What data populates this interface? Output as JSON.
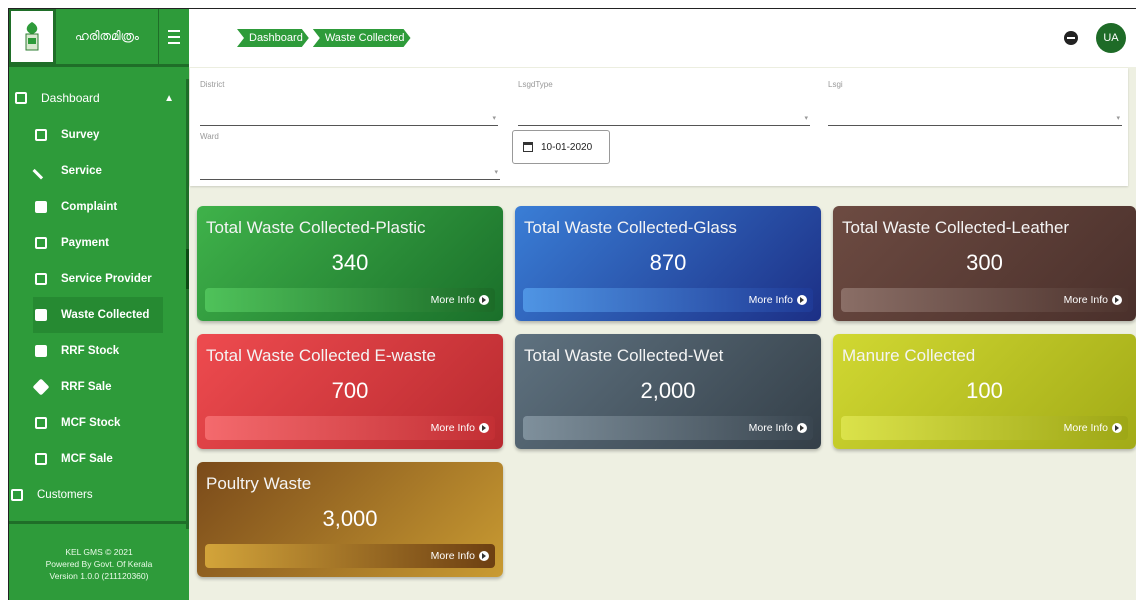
{
  "brand": {
    "name": "ഹരിതമിത്രം"
  },
  "breadcrumb": [
    {
      "label": "Dashboard"
    },
    {
      "label": "Waste Collected"
    }
  ],
  "user": {
    "initials": "UA"
  },
  "sidebar": {
    "head": {
      "label": "Dashboard"
    },
    "items": [
      {
        "label": "Survey"
      },
      {
        "label": "Service"
      },
      {
        "label": "Complaint"
      },
      {
        "label": "Payment"
      },
      {
        "label": "Service Provider"
      },
      {
        "label": "Waste Collected"
      },
      {
        "label": "RRF Stock"
      },
      {
        "label": "RRF Sale"
      },
      {
        "label": "MCF Stock"
      },
      {
        "label": "MCF Sale"
      }
    ],
    "customers": {
      "label": "Customers"
    },
    "footer": {
      "line1": "KEL GMS © 2021",
      "line2": "Powered By Govt. Of Kerala",
      "line3": "Version 1.0.0 (211120360)"
    }
  },
  "filters": {
    "district": {
      "label": "District"
    },
    "lsgd_type": {
      "label": "LsgdType"
    },
    "lsgi": {
      "label": "Lsgi"
    },
    "ward": {
      "label": "Ward"
    },
    "date": {
      "value": "10-01-2020"
    }
  },
  "cards": [
    {
      "title": "Total Waste Collected-Plastic",
      "value": "340",
      "more": "More Info"
    },
    {
      "title": "Total Waste Collected-Glass",
      "value": "870",
      "more": "More Info"
    },
    {
      "title": "Total Waste Collected-Leather",
      "value": "300",
      "more": "More Info"
    },
    {
      "title": "Total Waste Collected E-waste",
      "value": "700",
      "more": "More Info"
    },
    {
      "title": "Total Waste Collected-Wet",
      "value": "2,000",
      "more": "More Info"
    },
    {
      "title": "Manure Collected",
      "value": "100",
      "more": "More Info"
    },
    {
      "title": "Poultry Waste",
      "value": "3,000",
      "more": "More Info"
    }
  ],
  "colors": {
    "sidebar": "#2e9b3a",
    "plastic": "#2a9a3c",
    "glass": "#2b57b8",
    "leather": "#5e4038",
    "ewaste": "#d93a3e",
    "wet": "#4d5d68",
    "manure": "#b9c21f",
    "poultry": "#a56f1a"
  }
}
